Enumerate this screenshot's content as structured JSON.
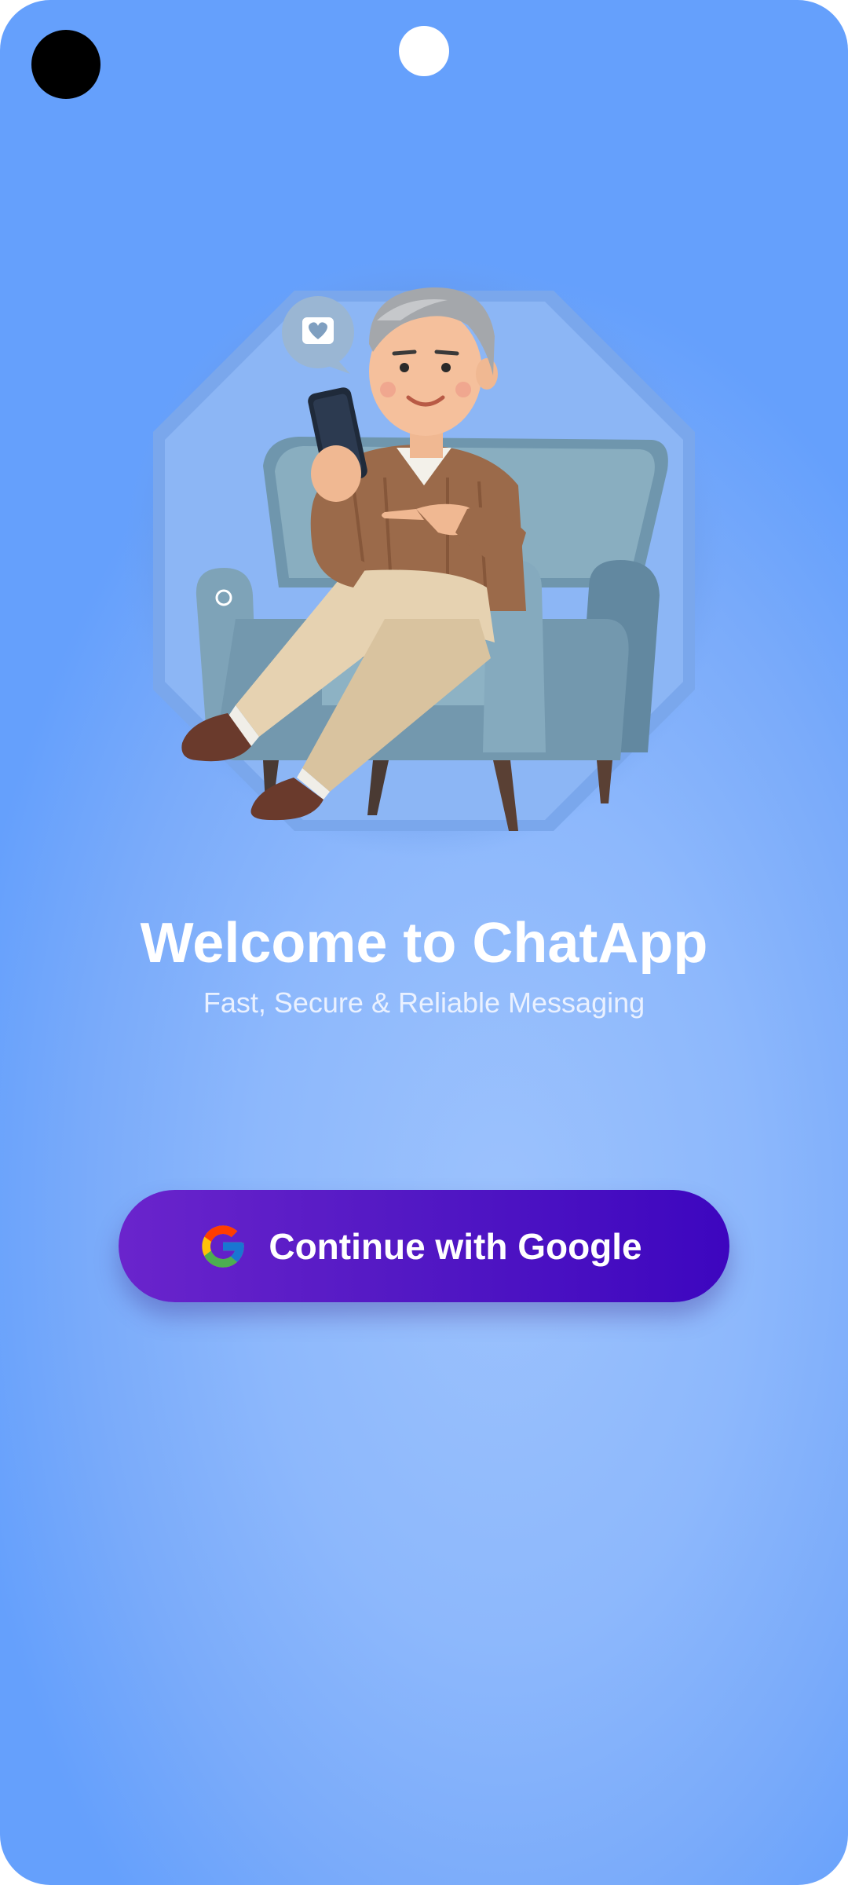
{
  "status": {
    "camera_icon": "camera-dot",
    "notch_icon": "notch-dot"
  },
  "hero": {
    "illustration": "man-in-armchair-with-phone-illustration",
    "bubble_icon": "heart-chat-bubble-icon"
  },
  "welcome": {
    "title": "Welcome to ChatApp",
    "subtitle": "Fast, Secure & Reliable Messaging"
  },
  "auth": {
    "google_button_label": "Continue with Google",
    "google_icon": "google-g-icon"
  },
  "colors": {
    "background_top": "#65a0fc",
    "background_center": "#9cc2fd",
    "button_start": "#6a24cc",
    "button_end": "#3d06bf",
    "text": "#ffffff"
  }
}
